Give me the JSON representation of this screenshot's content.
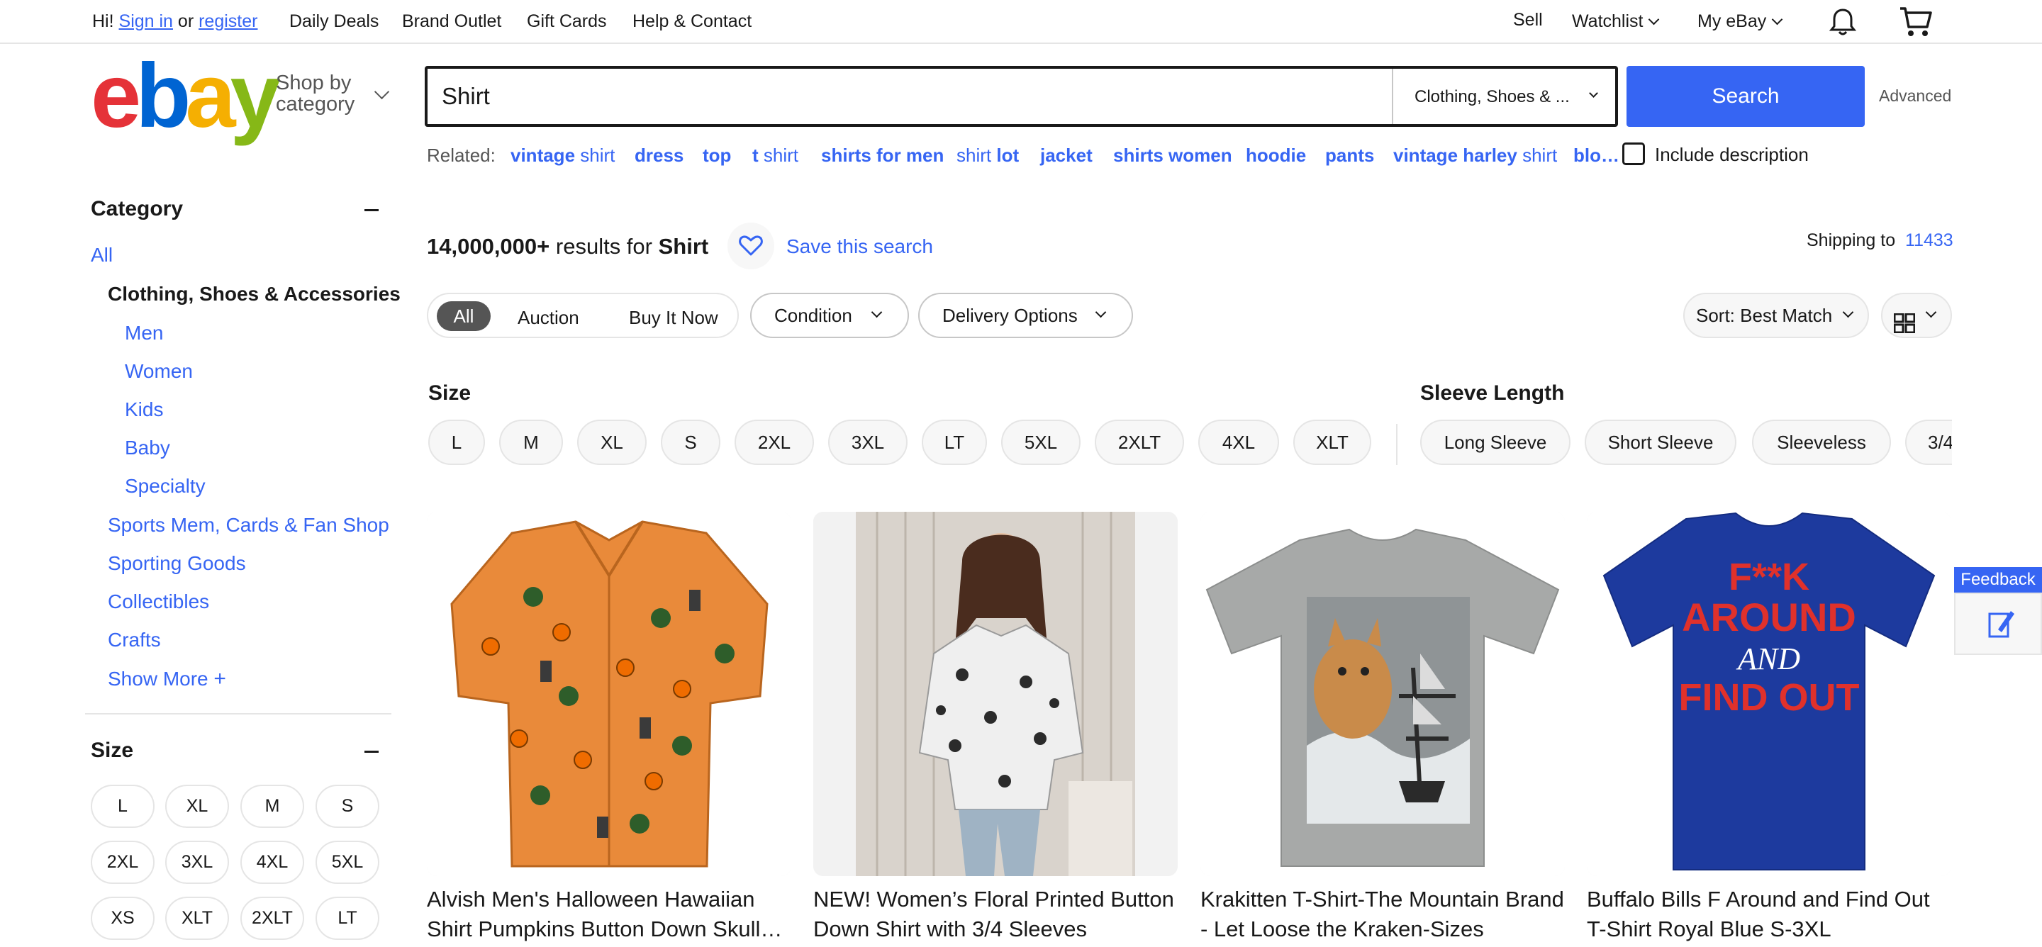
{
  "topbar": {
    "greeting": "Hi!",
    "sign_in": "Sign in",
    "or": "or",
    "register": "register",
    "nav": [
      "Daily Deals",
      "Brand Outlet",
      "Gift Cards",
      "Help & Contact"
    ],
    "sell": "Sell",
    "watchlist": "Watchlist",
    "my_ebay": "My eBay"
  },
  "header": {
    "logo_letters": [
      "e",
      "b",
      "a",
      "y"
    ],
    "shop_by_line1": "Shop by",
    "shop_by_line2": "category",
    "search_value": "Shirt",
    "category_select": "Clothing, Shoes & ...",
    "search_button": "Search",
    "advanced": "Advanced"
  },
  "related": {
    "label": "Related:",
    "items": [
      {
        "a": "vintage",
        "b": "shirt"
      },
      {
        "a": "dress",
        "b": ""
      },
      {
        "a": "top",
        "b": ""
      },
      {
        "a": "t",
        "b": "shirt"
      },
      {
        "a": "shirts for men",
        "b": ""
      },
      {
        "a": "shirt",
        "b": "lot"
      },
      {
        "a": "jacket",
        "b": ""
      },
      {
        "a": "shirts women",
        "b": ""
      },
      {
        "a": "hoodie",
        "b": ""
      },
      {
        "a": "pants",
        "b": ""
      },
      {
        "a": "vintage harley",
        "b": "shirt"
      },
      {
        "a": "blo…",
        "b": ""
      }
    ],
    "include_description": "Include description"
  },
  "sidebar": {
    "category_heading": "Category",
    "all": "All",
    "current": "Clothing, Shoes & Accessories",
    "sub": [
      "Men",
      "Women",
      "Kids",
      "Baby",
      "Specialty"
    ],
    "others": [
      "Sports Mem, Cards & Fan Shop",
      "Sporting Goods",
      "Collectibles",
      "Crafts"
    ],
    "show_more": "Show More",
    "size_heading": "Size",
    "sizes": [
      "L",
      "XL",
      "M",
      "S",
      "2XL",
      "3XL",
      "4XL",
      "5XL",
      "XS",
      "XLT",
      "2XLT",
      "LT"
    ]
  },
  "results": {
    "count": "14,000,000+",
    "results_for": "results for",
    "query": "Shirt",
    "save_search": "Save this search",
    "shipping_to": "Shipping to",
    "zip": "11433"
  },
  "filters": {
    "buying": [
      "All",
      "Auction",
      "Buy It Now"
    ],
    "condition": "Condition",
    "delivery": "Delivery Options",
    "sort": "Sort: Best Match"
  },
  "aspects": {
    "size_heading": "Size",
    "sizes": [
      "L",
      "M",
      "XL",
      "S",
      "2XL",
      "3XL",
      "LT",
      "5XL",
      "2XLT",
      "4XL",
      "XLT"
    ],
    "sleeve_heading": "Sleeve Length",
    "sleeves": [
      "Long Sleeve",
      "Short Sleeve",
      "Sleeveless",
      "3/4"
    ]
  },
  "products": [
    {
      "title": "Alvish Men's Halloween Hawaiian Shirt Pumpkins Button Down Skull…"
    },
    {
      "title": "NEW! Women’s Floral Printed Button Down Shirt with 3/4 Sleeves"
    },
    {
      "title": "Krakitten T-Shirt-The Mountain Brand - Let Loose the Kraken-Sizes Small-…"
    },
    {
      "title": "Buffalo Bills F Around and Find Out T-Shirt Royal Blue S-3XL"
    }
  ],
  "shirt_print": {
    "line1": "F**K",
    "line2": "AROUND",
    "line3": "AND",
    "line4": "FIND OUT"
  },
  "feedback": "Feedback",
  "colors": {
    "ebay_red": "#e53238",
    "ebay_blue": "#0064d2",
    "ebay_yellow": "#f5af02",
    "ebay_green": "#86b817",
    "link": "#3665f3"
  }
}
